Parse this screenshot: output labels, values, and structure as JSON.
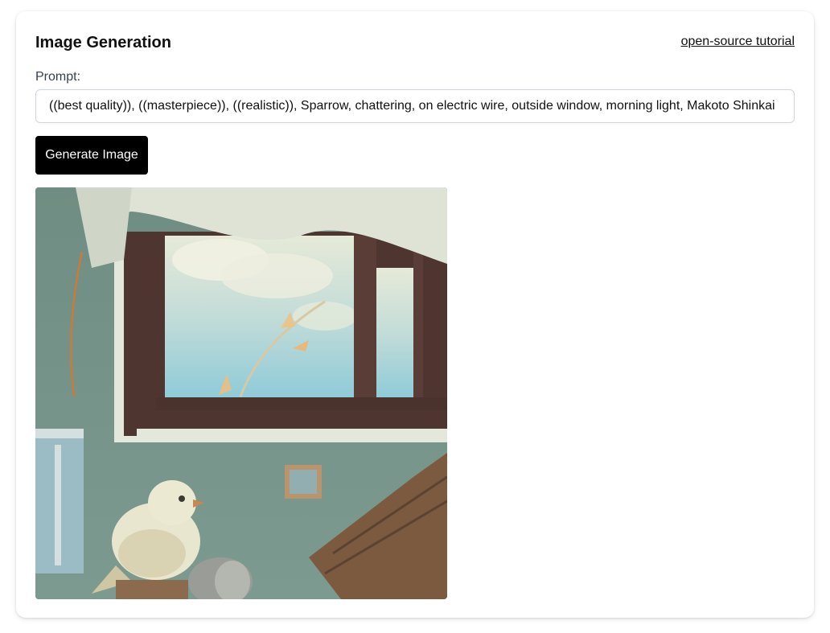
{
  "header": {
    "title": "Image Generation",
    "tutorial_link": "open-source tutorial"
  },
  "prompt": {
    "label": "Prompt:",
    "value": "((best quality)), ((masterpiece)), ((realistic)), Sparrow, chattering, on electric wire, outside window, morning light, Makoto Shinkai"
  },
  "actions": {
    "generate_label": "Generate Image"
  },
  "result": {
    "alt": "Generated image: sparrow inside a room by a window in morning light"
  },
  "colors": {
    "button_bg": "#000000",
    "button_text": "#ffffff",
    "wall": "#7f9a8f",
    "sky": "#a9d4dc",
    "curtain": "#dfe5d8",
    "window_frame": "#5a3d36"
  }
}
